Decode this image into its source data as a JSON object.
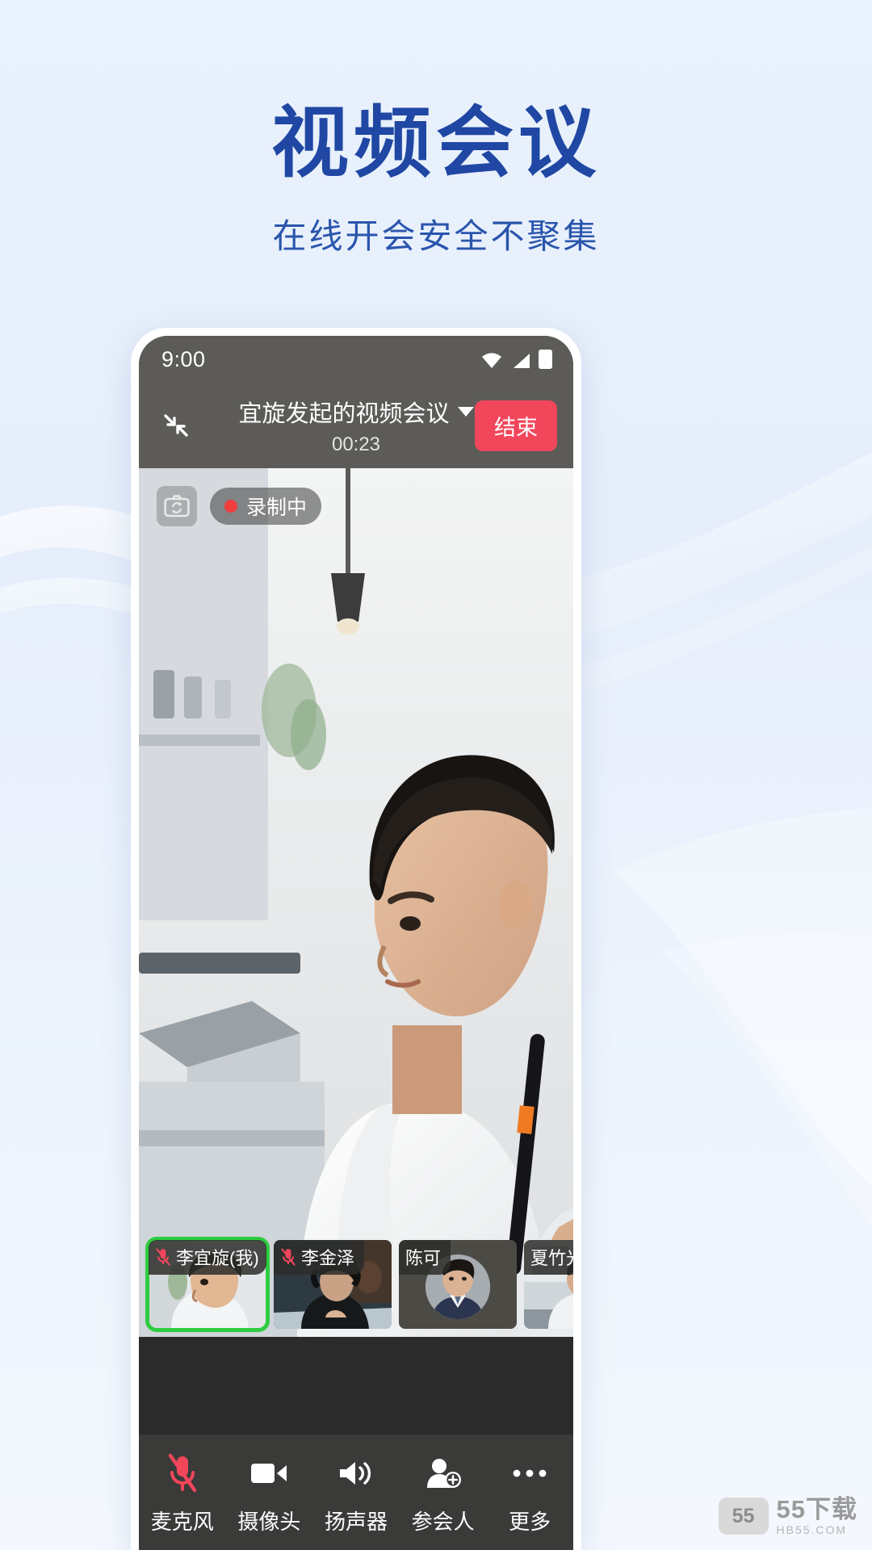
{
  "promo": {
    "headline": "视频会议",
    "subhead": "在线开会安全不聚集",
    "headline_color": "#1f47a3",
    "subhead_color": "#2a55ad",
    "background_color": "#eaf2fd"
  },
  "phone": {
    "status_bar": {
      "time": "9:00",
      "icons": [
        "wifi-icon",
        "signal-icon",
        "battery-icon"
      ]
    },
    "meeting_header": {
      "minimize_icon": "minimize-icon",
      "title": "宜旋发起的视频会议",
      "title_caret_icon": "chevron-down-icon",
      "timer": "00:23",
      "end_button": "结束",
      "end_button_color": "#f2465b",
      "background_color": "#5c5b58"
    },
    "stage": {
      "camera_flip_icon": "camera-flip-icon",
      "recording_badge": "录制中",
      "recording_dot_color": "#f03d3d"
    },
    "thumbnails": [
      {
        "name": "李宜旋(我)",
        "muted": true,
        "selected": true,
        "kind": "video-profile"
      },
      {
        "name": "李金泽",
        "muted": true,
        "selected": false,
        "kind": "video-headset"
      },
      {
        "name": "陈可",
        "muted": false,
        "selected": false,
        "kind": "avatar"
      },
      {
        "name": "夏竹光",
        "muted": false,
        "selected": false,
        "kind": "video-office"
      }
    ],
    "thumbnail_selected_color": "#2ecc41",
    "toolbar": [
      {
        "label": "麦克风",
        "icon": "microphone-off-icon",
        "state": "muted",
        "color": "#f2465b"
      },
      {
        "label": "摄像头",
        "icon": "video-camera-icon",
        "state": "on",
        "color": "#ffffff"
      },
      {
        "label": "扬声器",
        "icon": "speaker-icon",
        "state": "on",
        "color": "#ffffff"
      },
      {
        "label": "参会人",
        "icon": "add-person-icon",
        "state": "on",
        "color": "#ffffff"
      },
      {
        "label": "更多",
        "icon": "more-dots-icon",
        "state": "on",
        "color": "#ffffff"
      }
    ]
  },
  "watermark": {
    "badge": "55",
    "main": "55下载",
    "sub": "HB55.COM"
  }
}
